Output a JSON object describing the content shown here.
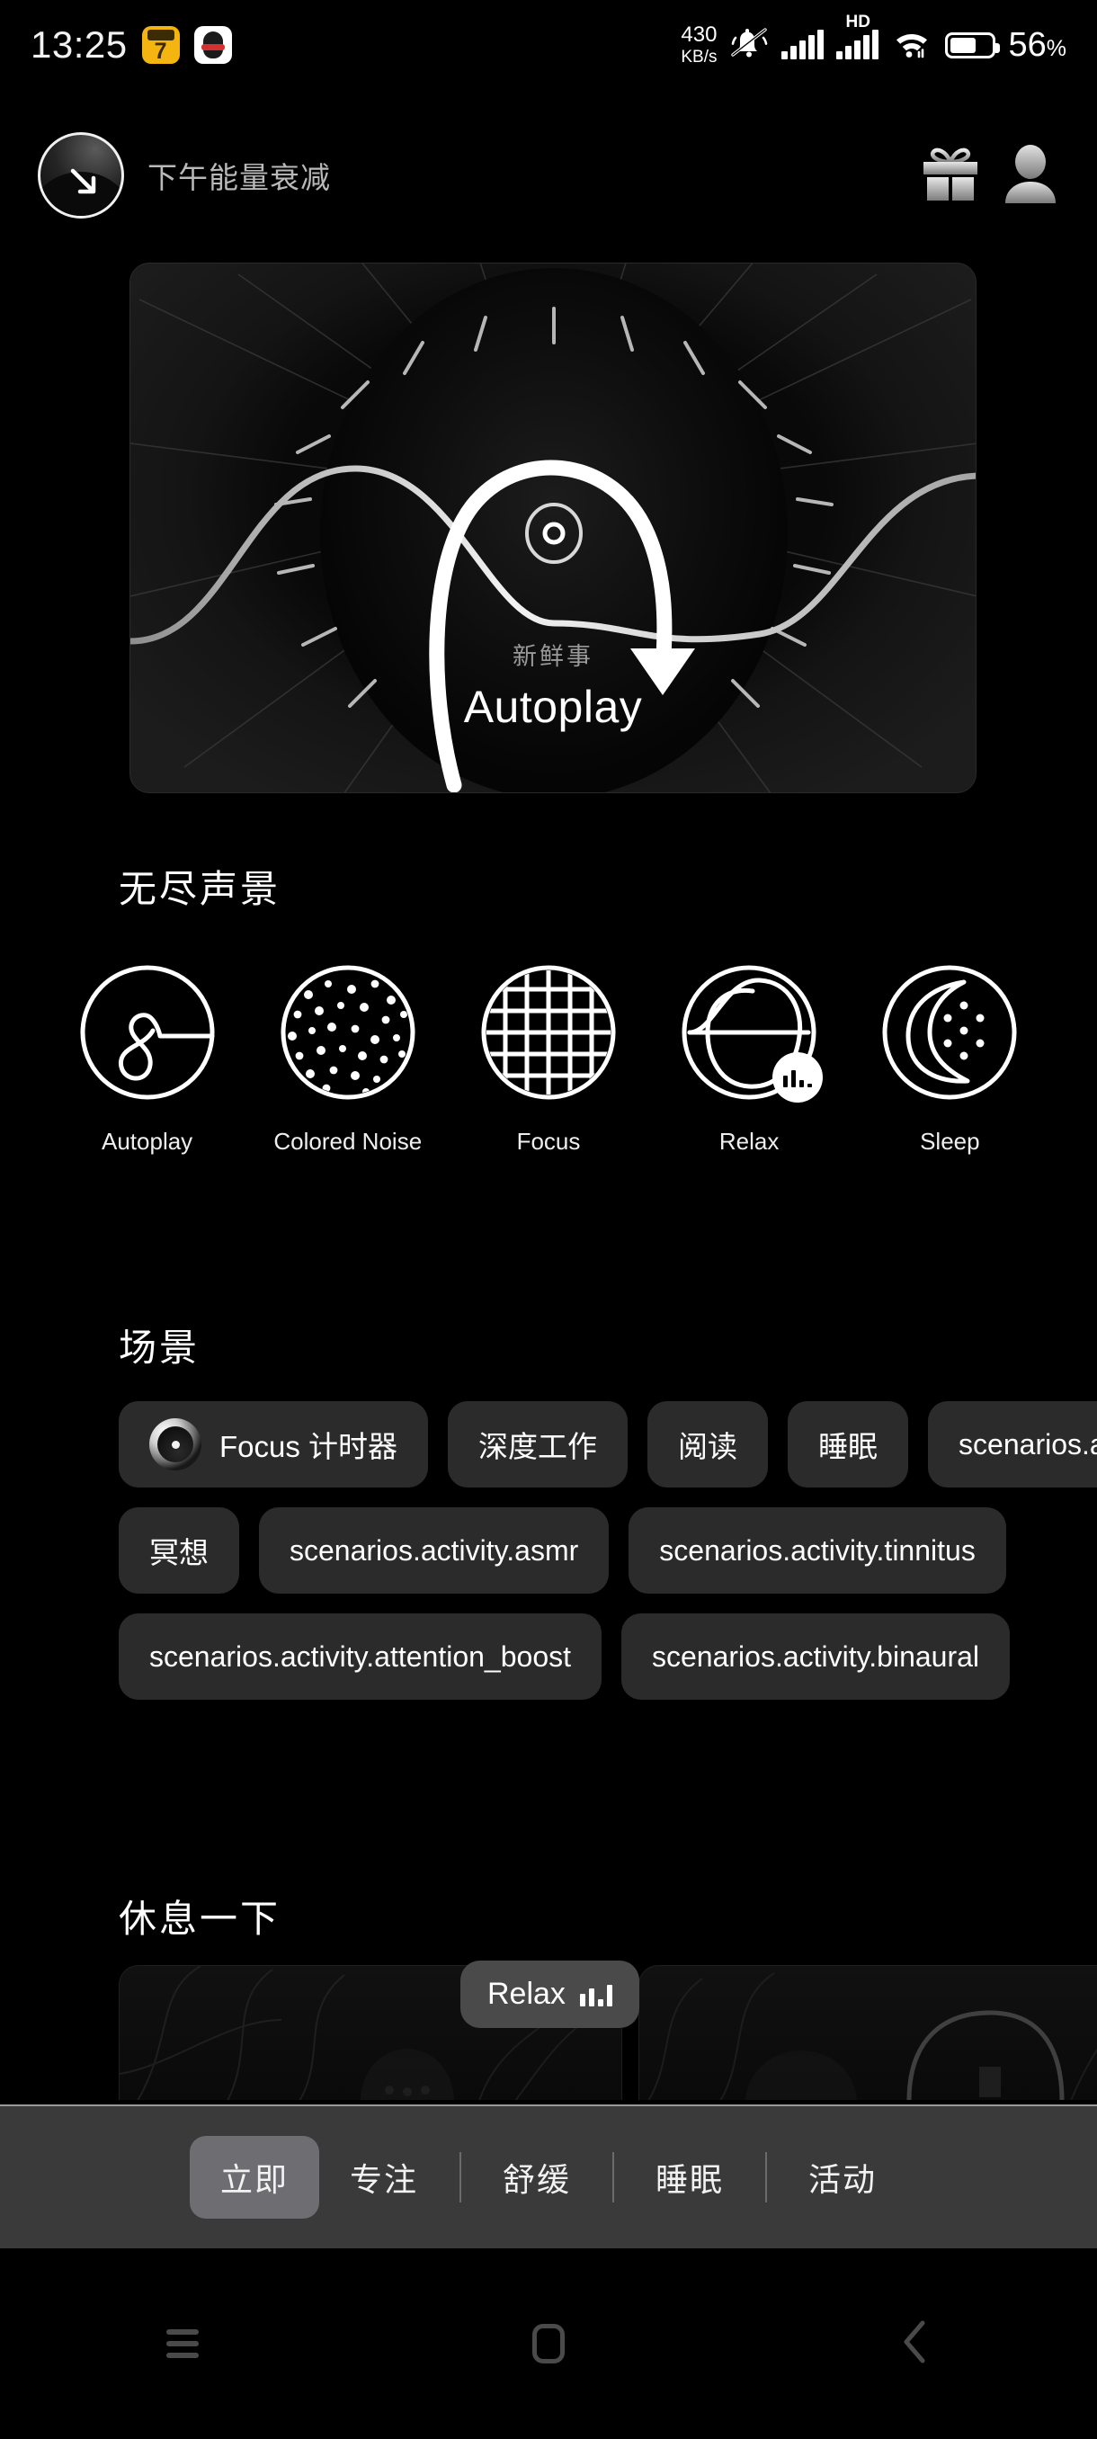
{
  "status_bar": {
    "time": "13:25",
    "app_icons": [
      "calendar-7-icon",
      "qq-penguin-icon"
    ],
    "network_speed_value": "430",
    "network_speed_unit": "KB/s",
    "icons": [
      "mute-bell-icon",
      "signal-bars-icon",
      "hd-icon",
      "wifi-icon",
      "battery-icon"
    ],
    "hd_label": "HD",
    "battery_percent": "56",
    "battery_percent_symbol": "%",
    "battery_level": 56
  },
  "header": {
    "status_icon": "energy-decline-dial-icon",
    "title": "下午能量衰减",
    "gift_label": "gift-icon",
    "avatar_label": "profile-avatar-icon"
  },
  "hero": {
    "subtitle": "新鲜事",
    "title": "Autoplay",
    "icon": "autoplay-dial-arrow-icon"
  },
  "soundscape": {
    "heading": "无尽声景",
    "items": [
      {
        "label": "Autoplay",
        "icon": "autoplay-loop-icon",
        "playing": false
      },
      {
        "label": "Colored Noise",
        "icon": "noise-dots-icon",
        "playing": false
      },
      {
        "label": "Focus",
        "icon": "grid-circle-icon",
        "playing": false
      },
      {
        "label": "Relax",
        "icon": "leaf-wave-icon",
        "playing": true
      },
      {
        "label": "Sleep",
        "icon": "crescent-moon-icon",
        "playing": false
      }
    ]
  },
  "scenarios": {
    "heading": "场景",
    "rows": [
      [
        {
          "label": "Focus 计时器",
          "icon": "focus-timer-dial-icon"
        },
        {
          "label": "深度工作"
        },
        {
          "label": "阅读"
        },
        {
          "label": "睡眠"
        },
        {
          "label": "scenarios.activity.r"
        }
      ],
      [
        {
          "label": "冥想"
        },
        {
          "label": "scenarios.activity.asmr"
        },
        {
          "label": "scenarios.activity.tinnitus"
        }
      ],
      [
        {
          "label": "scenarios.activity.attention_boost"
        },
        {
          "label": "scenarios.activity.binaural"
        }
      ]
    ]
  },
  "break_section": {
    "heading": "休息一下",
    "now_playing_pill": {
      "label": "Relax",
      "indicator": "equalizer-bars-icon"
    },
    "cards": [
      {
        "art": "mushroom-line-art"
      },
      {
        "art": "arch-line-art"
      },
      {
        "art": "palm-line-art"
      }
    ]
  },
  "tab_bar": {
    "tabs": [
      {
        "label": "立即",
        "active": true
      },
      {
        "label": "专注",
        "active": false
      },
      {
        "label": "舒缓",
        "active": false
      },
      {
        "label": "睡眠",
        "active": false
      },
      {
        "label": "活动",
        "active": false
      }
    ],
    "active_background": "#6e6e72",
    "background": "#3a3a3a"
  },
  "nav_bar": {
    "buttons": [
      {
        "icon": "recents-menu-icon"
      },
      {
        "icon": "home-square-icon"
      },
      {
        "icon": "back-chevron-icon"
      }
    ]
  },
  "colors": {
    "background": "#000000",
    "chip": "#2b2b2b",
    "accent_text": "#ffffff",
    "muted_text": "#b9b9b9"
  }
}
